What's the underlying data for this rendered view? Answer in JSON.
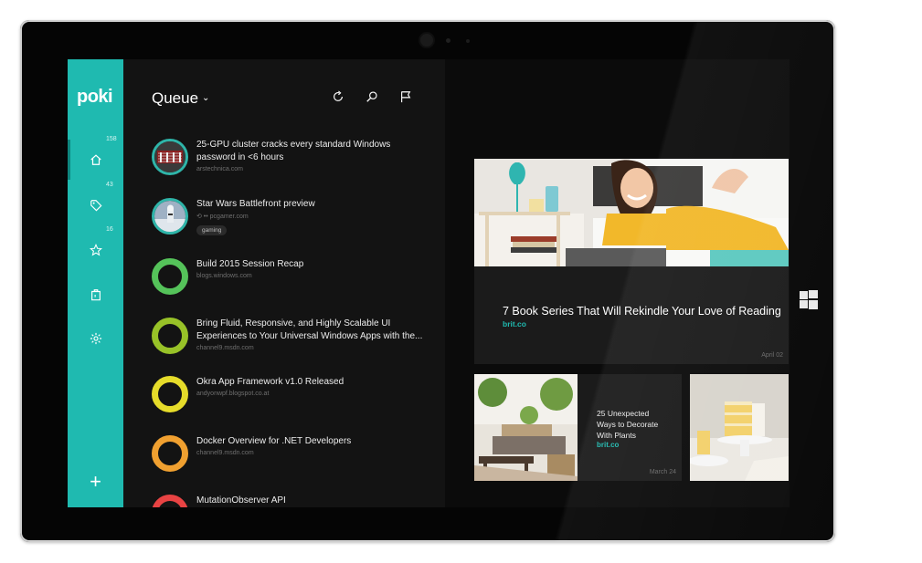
{
  "app": {
    "logo": "poki"
  },
  "sidebar": {
    "items": [
      {
        "icon": "home-icon",
        "count": "158"
      },
      {
        "icon": "tag-icon",
        "count": "43"
      },
      {
        "icon": "star-icon",
        "count": "16"
      },
      {
        "icon": "bag-icon",
        "count": ""
      },
      {
        "icon": "gear-icon",
        "count": ""
      }
    ],
    "add_label": "+"
  },
  "queue": {
    "title": "Queue",
    "chevron": "⌄",
    "items": [
      {
        "title": "25-GPU cluster cracks every standard Windows password in <6 hours",
        "source": "arstechnica.com",
        "thumb": "image"
      },
      {
        "title": "Star Wars Battlefront preview",
        "source": "⟲ •• pcgamer.com",
        "tag": "gaming",
        "thumb": "image"
      },
      {
        "title": "Build 2015 Session Recap",
        "source": "blogs.windows.com",
        "thumb": "ring",
        "color": "#55c35a"
      },
      {
        "title": "Bring Fluid, Responsive, and Highly Scalable UI Experiences to Your Universal Windows Apps with the...",
        "source": "channel9.msdn.com",
        "thumb": "ring",
        "color": "#98c228"
      },
      {
        "title": "Okra App Framework v1.0 Released",
        "source": "andyonwpf.blogspot.co.at",
        "thumb": "ring",
        "color": "#e6dc2a"
      },
      {
        "title": "Docker Overview for .NET Developers",
        "source": "channel9.msdn.com",
        "thumb": "ring",
        "color": "#f0a030"
      },
      {
        "title": "MutationObserver API",
        "source": "",
        "thumb": "ring",
        "color": "#e84343"
      }
    ]
  },
  "featured": {
    "title": "7 Book Series That Will Rekindle Your Love of Reading",
    "source": "brit.co",
    "date": "April 02"
  },
  "secondary": {
    "title": "25 Unexpected Ways to Decorate With Plants",
    "source": "brit.co",
    "date": "March 24"
  },
  "colors": {
    "accent": "#1fbab0",
    "panel": "#131313",
    "card": "#1b1b1b"
  }
}
